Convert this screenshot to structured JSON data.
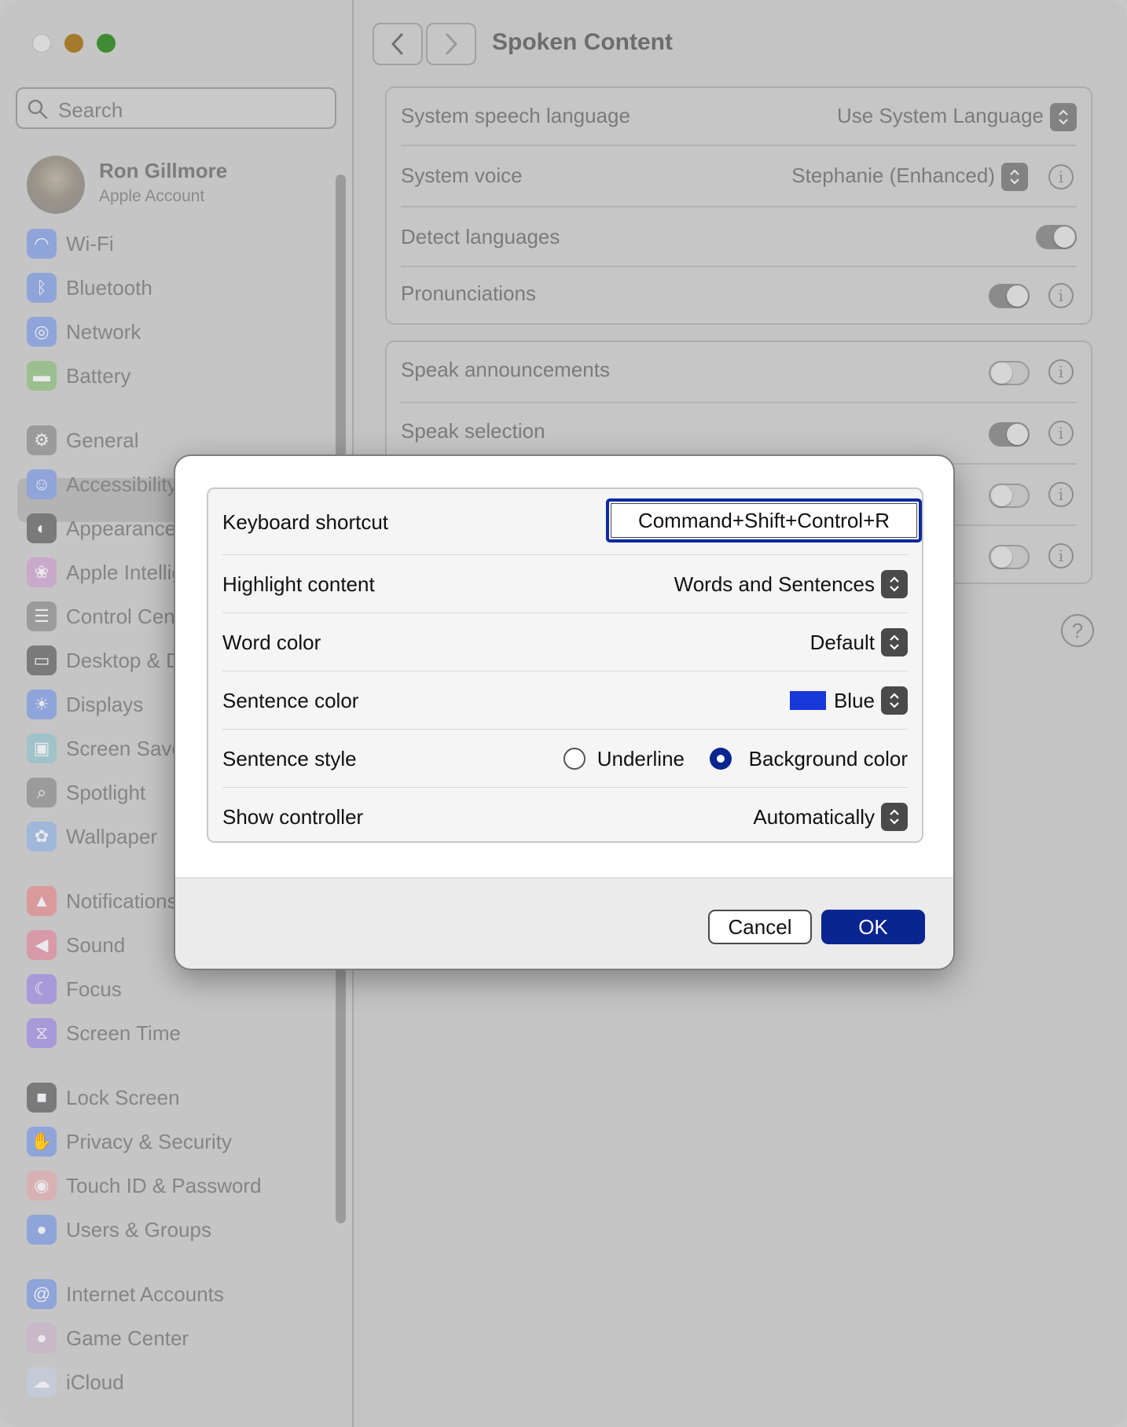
{
  "sidebar": {
    "search_placeholder": "Search",
    "account": {
      "name": "Ron Gillmore",
      "subtitle": "Apple Account"
    },
    "items": [
      {
        "label": "Wi-Fi",
        "icon": "wifi-icon",
        "color": "#8fa4d8"
      },
      {
        "label": "Bluetooth",
        "icon": "bluetooth-icon",
        "color": "#8fa4d8"
      },
      {
        "label": "Network",
        "icon": "globe-icon",
        "color": "#8fa4d8"
      },
      {
        "label": "Battery",
        "icon": "battery-icon",
        "color": "#9bbf8e"
      },
      {
        "label": "General",
        "icon": "gear-icon",
        "color": "#9b9b9b"
      },
      {
        "label": "Accessibility",
        "icon": "accessibility-icon",
        "color": "#8fa4d8"
      },
      {
        "label": "Appearance",
        "icon": "appearance-icon",
        "color": "#7a7a7a"
      },
      {
        "label": "Apple Intelligence & Siri",
        "icon": "siri-icon",
        "color": "#c9a9c9"
      },
      {
        "label": "Control Centre",
        "icon": "control-centre-icon",
        "color": "#9b9b9b"
      },
      {
        "label": "Desktop & Dock",
        "icon": "desktop-dock-icon",
        "color": "#7a7a7a"
      },
      {
        "label": "Displays",
        "icon": "displays-icon",
        "color": "#8fa4d8"
      },
      {
        "label": "Screen Saver",
        "icon": "screen-saver-icon",
        "color": "#9fc3c9"
      },
      {
        "label": "Spotlight",
        "icon": "spotlight-icon",
        "color": "#9b9b9b"
      },
      {
        "label": "Wallpaper",
        "icon": "wallpaper-icon",
        "color": "#9fb7d8"
      },
      {
        "label": "Notifications",
        "icon": "notifications-icon",
        "color": "#d89a9a"
      },
      {
        "label": "Sound",
        "icon": "sound-icon",
        "color": "#d89aa8"
      },
      {
        "label": "Focus",
        "icon": "focus-icon",
        "color": "#a89ad8"
      },
      {
        "label": "Screen Time",
        "icon": "screen-time-icon",
        "color": "#a89ad8"
      },
      {
        "label": "Lock Screen",
        "icon": "lock-icon",
        "color": "#7a7a7a"
      },
      {
        "label": "Privacy & Security",
        "icon": "hand-icon",
        "color": "#8fa4d8"
      },
      {
        "label": "Touch ID & Password",
        "icon": "fingerprint-icon",
        "color": "#d8b2b2"
      },
      {
        "label": "Users & Groups",
        "icon": "users-icon",
        "color": "#8fa4d8"
      },
      {
        "label": "Internet Accounts",
        "icon": "at-icon",
        "color": "#8fa4d8"
      },
      {
        "label": "Game Center",
        "icon": "game-center-icon",
        "color": "#c8b8c8"
      },
      {
        "label": "iCloud",
        "icon": "icloud-icon",
        "color": "#c4cad6"
      }
    ]
  },
  "main": {
    "title": "Spoken Content",
    "group1": [
      {
        "label": "System speech language",
        "value": "Use System Language"
      },
      {
        "label": "System voice",
        "value": "Stephanie (Enhanced)"
      },
      {
        "label": "Detect languages",
        "toggle": "on"
      },
      {
        "label": "Pronunciations",
        "toggle": "on"
      }
    ],
    "group2": [
      {
        "label": "Speak announcements",
        "toggle": "off"
      },
      {
        "label": "Speak selection",
        "toggle": "on"
      },
      {
        "label": "",
        "toggle": "off"
      },
      {
        "label": "",
        "toggle": "off"
      }
    ],
    "help_label": "?"
  },
  "dialog": {
    "keyboard_shortcut": {
      "label": "Keyboard shortcut",
      "value": "Command+Shift+Control+R"
    },
    "highlight_content": {
      "label": "Highlight content",
      "value": "Words and Sentences"
    },
    "word_color": {
      "label": "Word color",
      "value": "Default"
    },
    "sentence_color": {
      "label": "Sentence color",
      "value": "Blue",
      "swatch": "#1737d8"
    },
    "sentence_style": {
      "label": "Sentence style",
      "option1": "Underline",
      "option2": "Background color",
      "selected": "Background color"
    },
    "show_controller": {
      "label": "Show controller",
      "value": "Automatically"
    },
    "cancel_label": "Cancel",
    "ok_label": "OK"
  }
}
